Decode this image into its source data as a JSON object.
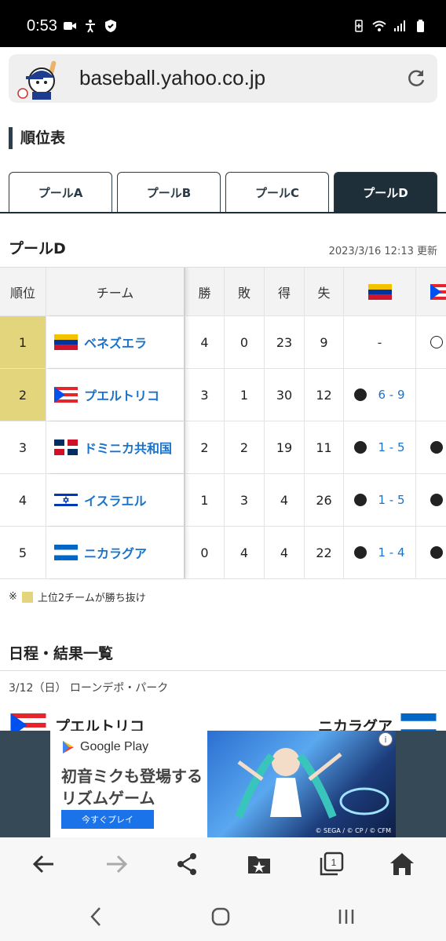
{
  "status_bar": {
    "time": "0:53",
    "left_icons": [
      "video-icon",
      "accessibility-icon",
      "shield-icon"
    ],
    "right_icons": [
      "battery-saver-icon",
      "wifi-icon",
      "signal-icon",
      "battery-icon"
    ]
  },
  "browser": {
    "url": "baseball.yahoo.co.jp"
  },
  "section_title": "順位表",
  "tabs": [
    {
      "label": "プールA",
      "active": false
    },
    {
      "label": "プールB",
      "active": false
    },
    {
      "label": "プールC",
      "active": false
    },
    {
      "label": "プールD",
      "active": true
    }
  ],
  "pool": {
    "title": "プールD",
    "updated": "2023/3/16 12:13 更新"
  },
  "standings": {
    "headers": {
      "rank": "順位",
      "team": "チーム",
      "wins": "勝",
      "losses": "敗",
      "runs_for": "得",
      "runs_against": "失"
    },
    "rows": [
      {
        "rank": "1",
        "team": "ベネズエラ",
        "flag": "venezuela",
        "wins": "4",
        "losses": "0",
        "runs_for": "23",
        "runs_against": "9",
        "vs1": "-",
        "vs1_mark": "",
        "vs2_mark": "ring",
        "qualified": true
      },
      {
        "rank": "2",
        "team": "プエルトリコ",
        "flag": "puerto-rico",
        "wins": "3",
        "losses": "1",
        "runs_for": "30",
        "runs_against": "12",
        "vs1": "6 - 9",
        "vs1_mark": "dot",
        "vs2_mark": "",
        "qualified": true
      },
      {
        "rank": "3",
        "team": "ドミニカ共和国",
        "flag": "dominican-republic",
        "wins": "2",
        "losses": "2",
        "runs_for": "19",
        "runs_against": "11",
        "vs1": "1 - 5",
        "vs1_mark": "dot",
        "vs2_mark": "dot",
        "qualified": false
      },
      {
        "rank": "4",
        "team": "イスラエル",
        "flag": "israel",
        "wins": "1",
        "losses": "3",
        "runs_for": "4",
        "runs_against": "26",
        "vs1": "1 - 5",
        "vs1_mark": "dot",
        "vs2_mark": "dot",
        "qualified": false
      },
      {
        "rank": "5",
        "team": "ニカラグア",
        "flag": "nicaragua",
        "wins": "0",
        "losses": "4",
        "runs_for": "4",
        "runs_against": "22",
        "vs1": "1 - 4",
        "vs1_mark": "dot",
        "vs2_mark": "dot",
        "qualified": false
      }
    ]
  },
  "note": {
    "prefix": "※",
    "text": "上位2チームが勝ち抜け"
  },
  "schedule": {
    "title": "日程・結果一覧",
    "date_venue": "3/12（日） ローンデポ・パーク",
    "match": {
      "home": "プエルトリコ",
      "away": "ニカラグア"
    }
  },
  "ad": {
    "store": "Google Play",
    "copy_line1": "初音ミクも登場する",
    "copy_line2": "リズムゲーム",
    "button": "今すぐプレイ",
    "credit": "© SEGA / © CP / © CFM"
  },
  "toolbar": {
    "tab_count": "1",
    "icons": [
      "back-icon",
      "forward-icon",
      "share-icon",
      "bookmarks-icon",
      "tabs-icon",
      "home-icon"
    ]
  },
  "colors": {
    "accent_dark": "#1e2f3a",
    "link": "#1a73c9",
    "qualified_bg": "#e3d57c"
  }
}
